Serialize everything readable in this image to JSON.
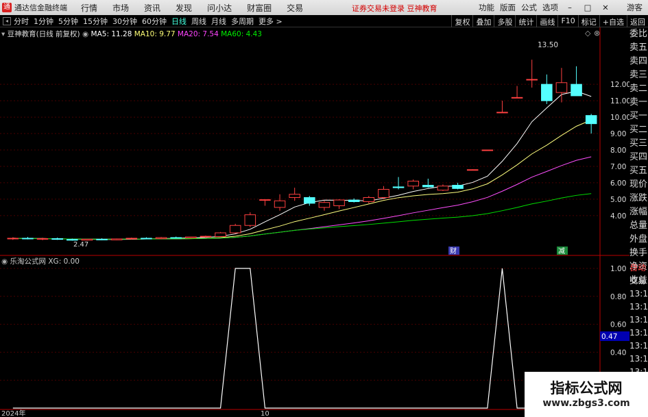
{
  "app": {
    "name": "通达信金融终端",
    "logo_glyph": "通"
  },
  "menu": [
    "行情",
    "市场",
    "资讯",
    "发现",
    "问小达",
    "财富圈",
    "交易"
  ],
  "promo": "证券交易未登录   豆神教育",
  "right_menu": [
    "功能",
    "版面",
    "公式",
    "选项"
  ],
  "window_buttons": [
    "–",
    "□",
    "✕"
  ],
  "guest": "游客",
  "periods": [
    "分时",
    "1分钟",
    "5分钟",
    "15分钟",
    "30分钟",
    "60分钟",
    "日线",
    "周线",
    "月线",
    "多周期",
    "更多 >"
  ],
  "active_period": "日线",
  "right_tools": [
    "复权",
    "叠加",
    "多股",
    "统计",
    "画线",
    "F10",
    "标记",
    "+自选",
    "返回"
  ],
  "main_legend": {
    "stock": "豆神教育(日线 前复权)",
    "ma5": "MA5: 11.28",
    "ma10": "MA10: 9.77",
    "ma20": "MA20: 7.54",
    "ma60": "MA60: 4.43",
    "colors": {
      "ma5": "#ffffff",
      "ma10": "#ffff7f",
      "ma20": "#ff4fff",
      "ma60": "#00e000"
    }
  },
  "price_axis": [
    "12.00",
    "11.00",
    "10.00",
    "9.00",
    "8.00",
    "7.00",
    "6.00",
    "5.00",
    "4.00"
  ],
  "high_label": "13.50",
  "low_label": "2.47",
  "event_markers": [
    "财",
    "减"
  ],
  "sub_legend": {
    "name": "乐淘公式网",
    "xg": "XG: 0.00"
  },
  "sub_axis": [
    "1.00",
    "0.80",
    "0.60",
    "0.40",
    "0.20"
  ],
  "sub_current": "0.47",
  "date_labels": [
    "2024年",
    "10"
  ],
  "order_book_labels": [
    "委比",
    "卖五",
    "卖四",
    "卖三",
    "卖二",
    "卖一",
    "买一",
    "买二",
    "买三",
    "买四",
    "买五",
    "现价",
    "涨跌",
    "涨幅",
    "总量",
    "外盘",
    "换手",
    "净资",
    "收益"
  ],
  "sub_side": [
    "自动",
    "交易",
    "13:13",
    "13:13",
    "13:13",
    "13:13",
    "13:13",
    "13:13",
    "13:13",
    "13:13",
    "13:13"
  ],
  "watermark": {
    "line1": "指标公式网",
    "line2": "www.zbgs3.com"
  },
  "candles": [
    {
      "o": 2.6,
      "h": 2.68,
      "l": 2.52,
      "c": 2.62
    },
    {
      "o": 2.62,
      "h": 2.7,
      "l": 2.55,
      "c": 2.58
    },
    {
      "o": 2.58,
      "h": 2.65,
      "l": 2.5,
      "c": 2.6
    },
    {
      "o": 2.6,
      "h": 2.66,
      "l": 2.52,
      "c": 2.55
    },
    {
      "o": 2.55,
      "h": 2.6,
      "l": 2.47,
      "c": 2.5
    },
    {
      "o": 2.5,
      "h": 2.58,
      "l": 2.47,
      "c": 2.56
    },
    {
      "o": 2.56,
      "h": 2.62,
      "l": 2.5,
      "c": 2.52
    },
    {
      "o": 2.52,
      "h": 2.6,
      "l": 2.5,
      "c": 2.58
    },
    {
      "o": 2.58,
      "h": 2.66,
      "l": 2.54,
      "c": 2.62
    },
    {
      "o": 2.62,
      "h": 2.68,
      "l": 2.56,
      "c": 2.6
    },
    {
      "o": 2.6,
      "h": 2.7,
      "l": 2.56,
      "c": 2.66
    },
    {
      "o": 2.66,
      "h": 2.72,
      "l": 2.6,
      "c": 2.64
    },
    {
      "o": 2.64,
      "h": 2.72,
      "l": 2.6,
      "c": 2.7
    },
    {
      "o": 2.7,
      "h": 2.78,
      "l": 2.66,
      "c": 2.74
    },
    {
      "o": 2.72,
      "h": 3.0,
      "l": 2.7,
      "c": 2.95
    },
    {
      "o": 2.95,
      "h": 3.5,
      "l": 2.9,
      "c": 3.4
    },
    {
      "o": 3.4,
      "h": 4.2,
      "l": 3.3,
      "c": 4.05
    },
    {
      "o": 4.95,
      "h": 4.98,
      "l": 4.6,
      "c": 4.97
    },
    {
      "o": 4.5,
      "h": 5.3,
      "l": 4.3,
      "c": 4.9
    },
    {
      "o": 5.1,
      "h": 5.7,
      "l": 4.9,
      "c": 5.3
    },
    {
      "o": 5.1,
      "h": 5.2,
      "l": 4.6,
      "c": 4.75
    },
    {
      "o": 4.5,
      "h": 4.9,
      "l": 4.3,
      "c": 4.8
    },
    {
      "o": 4.6,
      "h": 5.0,
      "l": 4.4,
      "c": 4.95
    },
    {
      "o": 4.95,
      "h": 5.05,
      "l": 4.8,
      "c": 4.85
    },
    {
      "o": 4.85,
      "h": 5.2,
      "l": 4.75,
      "c": 5.1
    },
    {
      "o": 5.1,
      "h": 5.8,
      "l": 5.0,
      "c": 5.6
    },
    {
      "o": 5.75,
      "h": 6.35,
      "l": 5.6,
      "c": 5.7
    },
    {
      "o": 5.8,
      "h": 6.2,
      "l": 5.6,
      "c": 6.1
    },
    {
      "o": 5.85,
      "h": 6.25,
      "l": 5.7,
      "c": 5.75
    },
    {
      "o": 5.55,
      "h": 5.9,
      "l": 5.5,
      "c": 5.8
    },
    {
      "o": 5.85,
      "h": 6.0,
      "l": 5.6,
      "c": 5.65
    },
    {
      "o": 6.8,
      "h": 6.82,
      "l": 6.78,
      "c": 6.8
    },
    {
      "o": 8.0,
      "h": 8.02,
      "l": 7.98,
      "c": 8.0
    },
    {
      "o": 10.3,
      "h": 11.0,
      "l": 10.3,
      "c": 10.3
    },
    {
      "o": 11.2,
      "h": 11.9,
      "l": 11.2,
      "c": 11.2
    },
    {
      "o": 12.3,
      "h": 13.5,
      "l": 11.8,
      "c": 12.3
    },
    {
      "o": 12.0,
      "h": 12.6,
      "l": 10.8,
      "c": 11.0
    },
    {
      "o": 11.5,
      "h": 13.0,
      "l": 10.9,
      "c": 12.1
    },
    {
      "o": 12.0,
      "h": 13.1,
      "l": 11.3,
      "c": 11.3
    },
    {
      "o": 10.1,
      "h": 10.2,
      "l": 9.0,
      "c": 9.6
    }
  ],
  "xg_signal": [
    0,
    0,
    0,
    0,
    0,
    0,
    0,
    0,
    0,
    0,
    0,
    0,
    0,
    0,
    0,
    1,
    1,
    0,
    0,
    0,
    0,
    0,
    0,
    0,
    0,
    0,
    0,
    0,
    0,
    0,
    0,
    0,
    0,
    1,
    0,
    0,
    0,
    0,
    0,
    0
  ]
}
